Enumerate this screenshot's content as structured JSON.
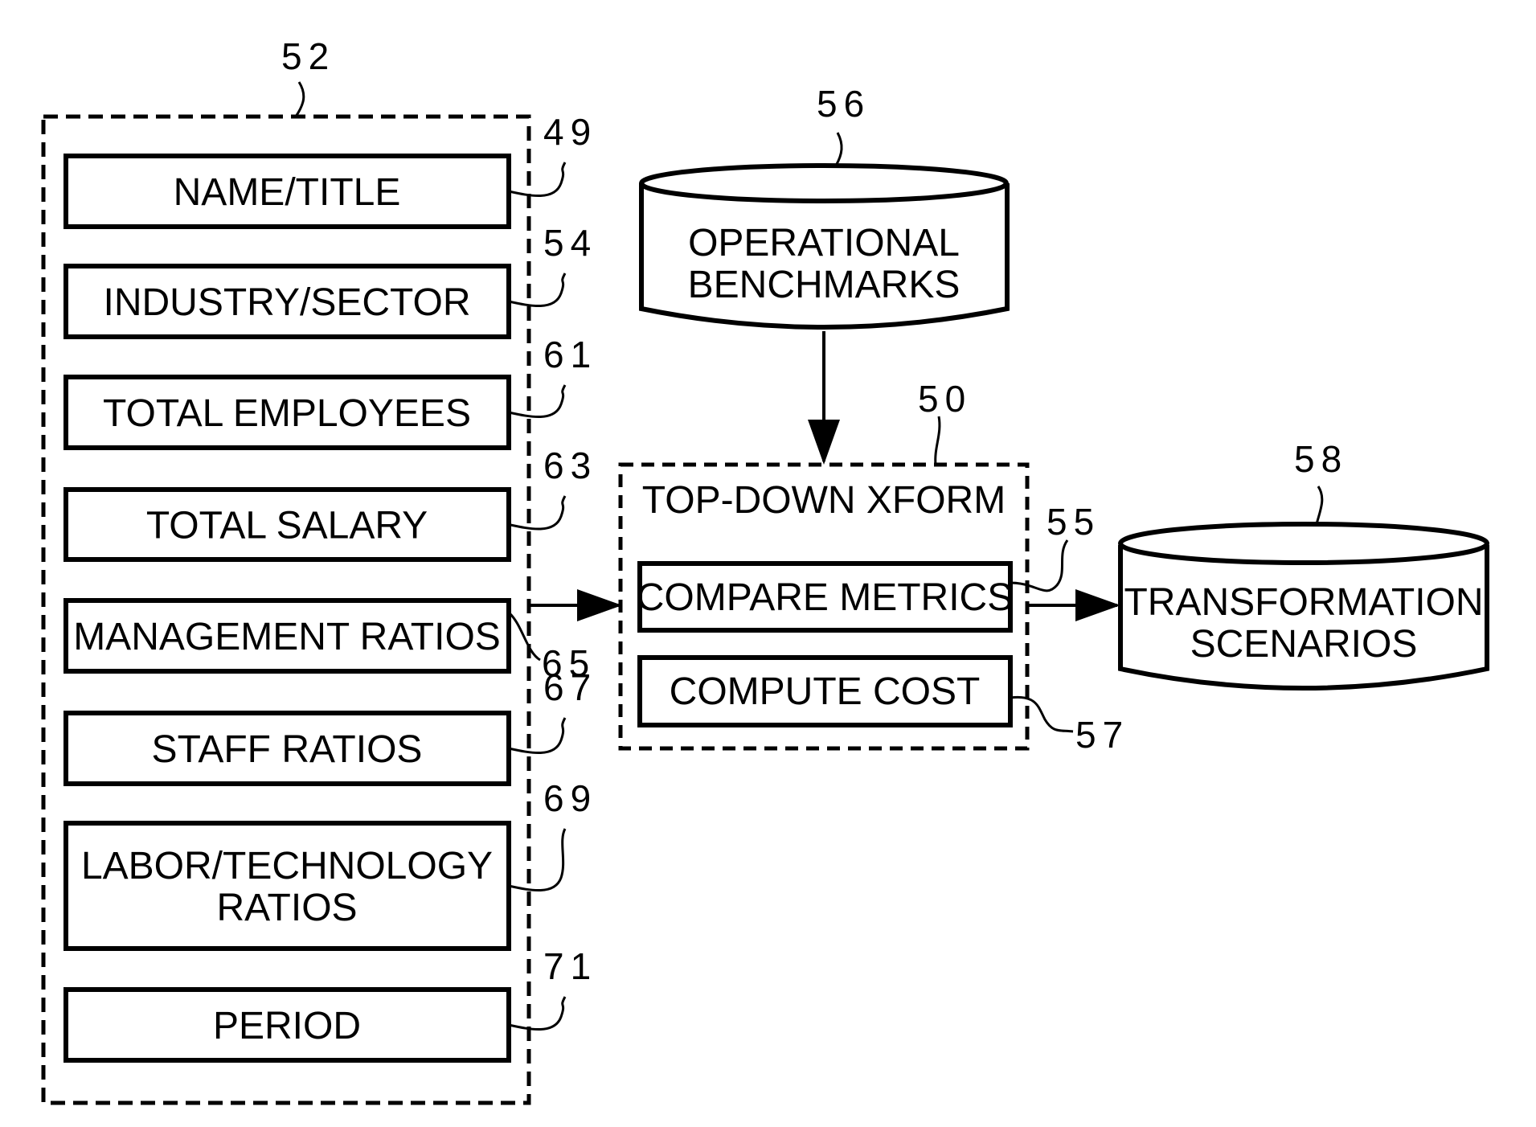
{
  "diagram": {
    "group_inputs": {
      "ref": "52",
      "fields": [
        {
          "ref": "49",
          "lines": [
            "NAME/TITLE"
          ]
        },
        {
          "ref": "54",
          "lines": [
            "INDUSTRY/SECTOR"
          ]
        },
        {
          "ref": "61",
          "lines": [
            "TOTAL EMPLOYEES"
          ]
        },
        {
          "ref": "63",
          "lines": [
            "TOTAL SALARY"
          ]
        },
        {
          "ref": "65",
          "lines": [
            "MANAGEMENT RATIOS"
          ]
        },
        {
          "ref": "67",
          "lines": [
            "STAFF RATIOS"
          ]
        },
        {
          "ref": "69",
          "lines": [
            "LABOR/TECHNOLOGY",
            "RATIOS"
          ]
        },
        {
          "ref": "71",
          "lines": [
            "PERIOD"
          ]
        }
      ]
    },
    "benchmarks_db": {
      "ref": "56",
      "lines": [
        "OPERATIONAL",
        "BENCHMARKS"
      ]
    },
    "xform": {
      "ref": "50",
      "title": "TOP-DOWN XFORM",
      "steps": [
        {
          "ref": "55",
          "label": "COMPARE METRICS"
        },
        {
          "ref": "57",
          "label": "COMPUTE COST"
        }
      ]
    },
    "scenarios_db": {
      "ref": "58",
      "lines": [
        "TRANSFORMATION",
        "SCENARIOS"
      ]
    }
  }
}
